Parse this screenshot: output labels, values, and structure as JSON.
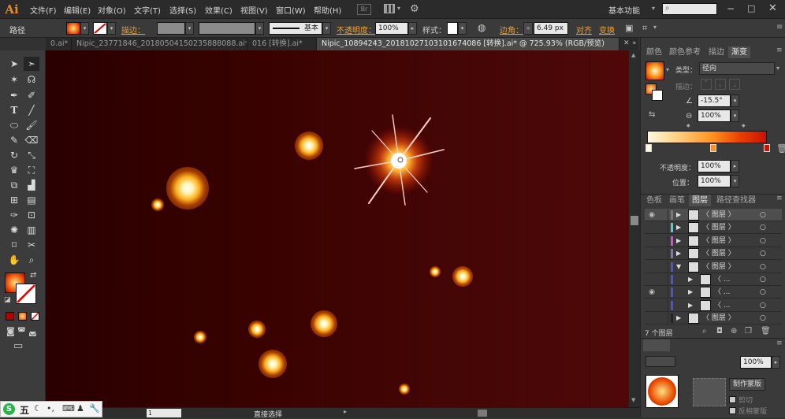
{
  "app": {
    "logo": "Ai"
  },
  "menu": {
    "items": [
      "文件(F)",
      "编辑(E)",
      "对象(O)",
      "文字(T)",
      "选择(S)",
      "效果(C)",
      "视图(V)",
      "窗口(W)",
      "帮助(H)"
    ],
    "br_label": "Br",
    "workspace": "基本功能"
  },
  "options": {
    "object_type": "路径",
    "stroke_label": "描边：",
    "stroke_profile": "基本",
    "opacity_label": "不透明度：",
    "opacity_value": "100%",
    "style_label": "样式：",
    "corner_label": "边角：",
    "corner_value": "6.49 px",
    "align_label": "对齐",
    "transform_label": "变换"
  },
  "tabs": [
    {
      "label": "0.ai*",
      "active": false
    },
    {
      "label": "Nipic_23771846_20180504150235888088.ai*",
      "active": false
    },
    {
      "label": "016 [转换].ai*",
      "active": false
    },
    {
      "label": "Nipic_10894243_20181027103101674086 [转换].ai* @ 725.93% (RGB/预览)",
      "active": true
    }
  ],
  "gradient_panel": {
    "tabs": [
      "颜色",
      "颜色参考",
      "描边",
      "渐变"
    ],
    "type_label": "类型：",
    "type_value": "径向",
    "stroke_label": "描边：",
    "angle_value": "-15.5°",
    "aspect_value": "100%",
    "opacity_label": "不透明度：",
    "opacity_value": "100%",
    "position_label": "位置：",
    "position_value": "100%"
  },
  "layers_panel": {
    "tabs": [
      "色板",
      "画笔",
      "图层",
      "路径查找器"
    ],
    "rows": [
      {
        "label": "〈 图层 〉",
        "color": "#7a7a7a",
        "visible": true
      },
      {
        "label": "〈 图层 〉",
        "color": "#4fd1d1",
        "visible": false
      },
      {
        "label": "〈 图层 〉",
        "color": "#d14fd1",
        "visible": false
      },
      {
        "label": "〈 图层 〉",
        "color": "#7a7aaa",
        "visible": false
      },
      {
        "label": "〈 图层 〉",
        "color": "#4f4fd1",
        "visible": false
      },
      {
        "label": "〈 ...",
        "color": "#4f4fd1",
        "visible": false
      },
      {
        "label": "〈 ...",
        "color": "#4f4fd1",
        "visible": true
      },
      {
        "label": "〈 ...",
        "color": "#4f4fd1",
        "visible": false
      },
      {
        "label": "〈 图层 〉",
        "color": "#222222",
        "visible": false
      }
    ],
    "count_label": "7 个图层"
  },
  "transparency_panel": {
    "opacity_value": "100%",
    "make_mask_label": "制作蒙版",
    "clip_label": "剪切",
    "invert_label": "反相蒙版"
  },
  "status": {
    "tool_name": "直接选择",
    "page_value": "1"
  },
  "ime": {
    "label": "五"
  },
  "colors": {
    "accent": "#e8882a",
    "canvas_dark": "#2a0000",
    "canvas_light": "#4f0808",
    "glow_core": "#fff3b0",
    "glow_mid": "#ffb020",
    "gradient_start": "#fff8e0",
    "gradient_end": "#c81400"
  }
}
